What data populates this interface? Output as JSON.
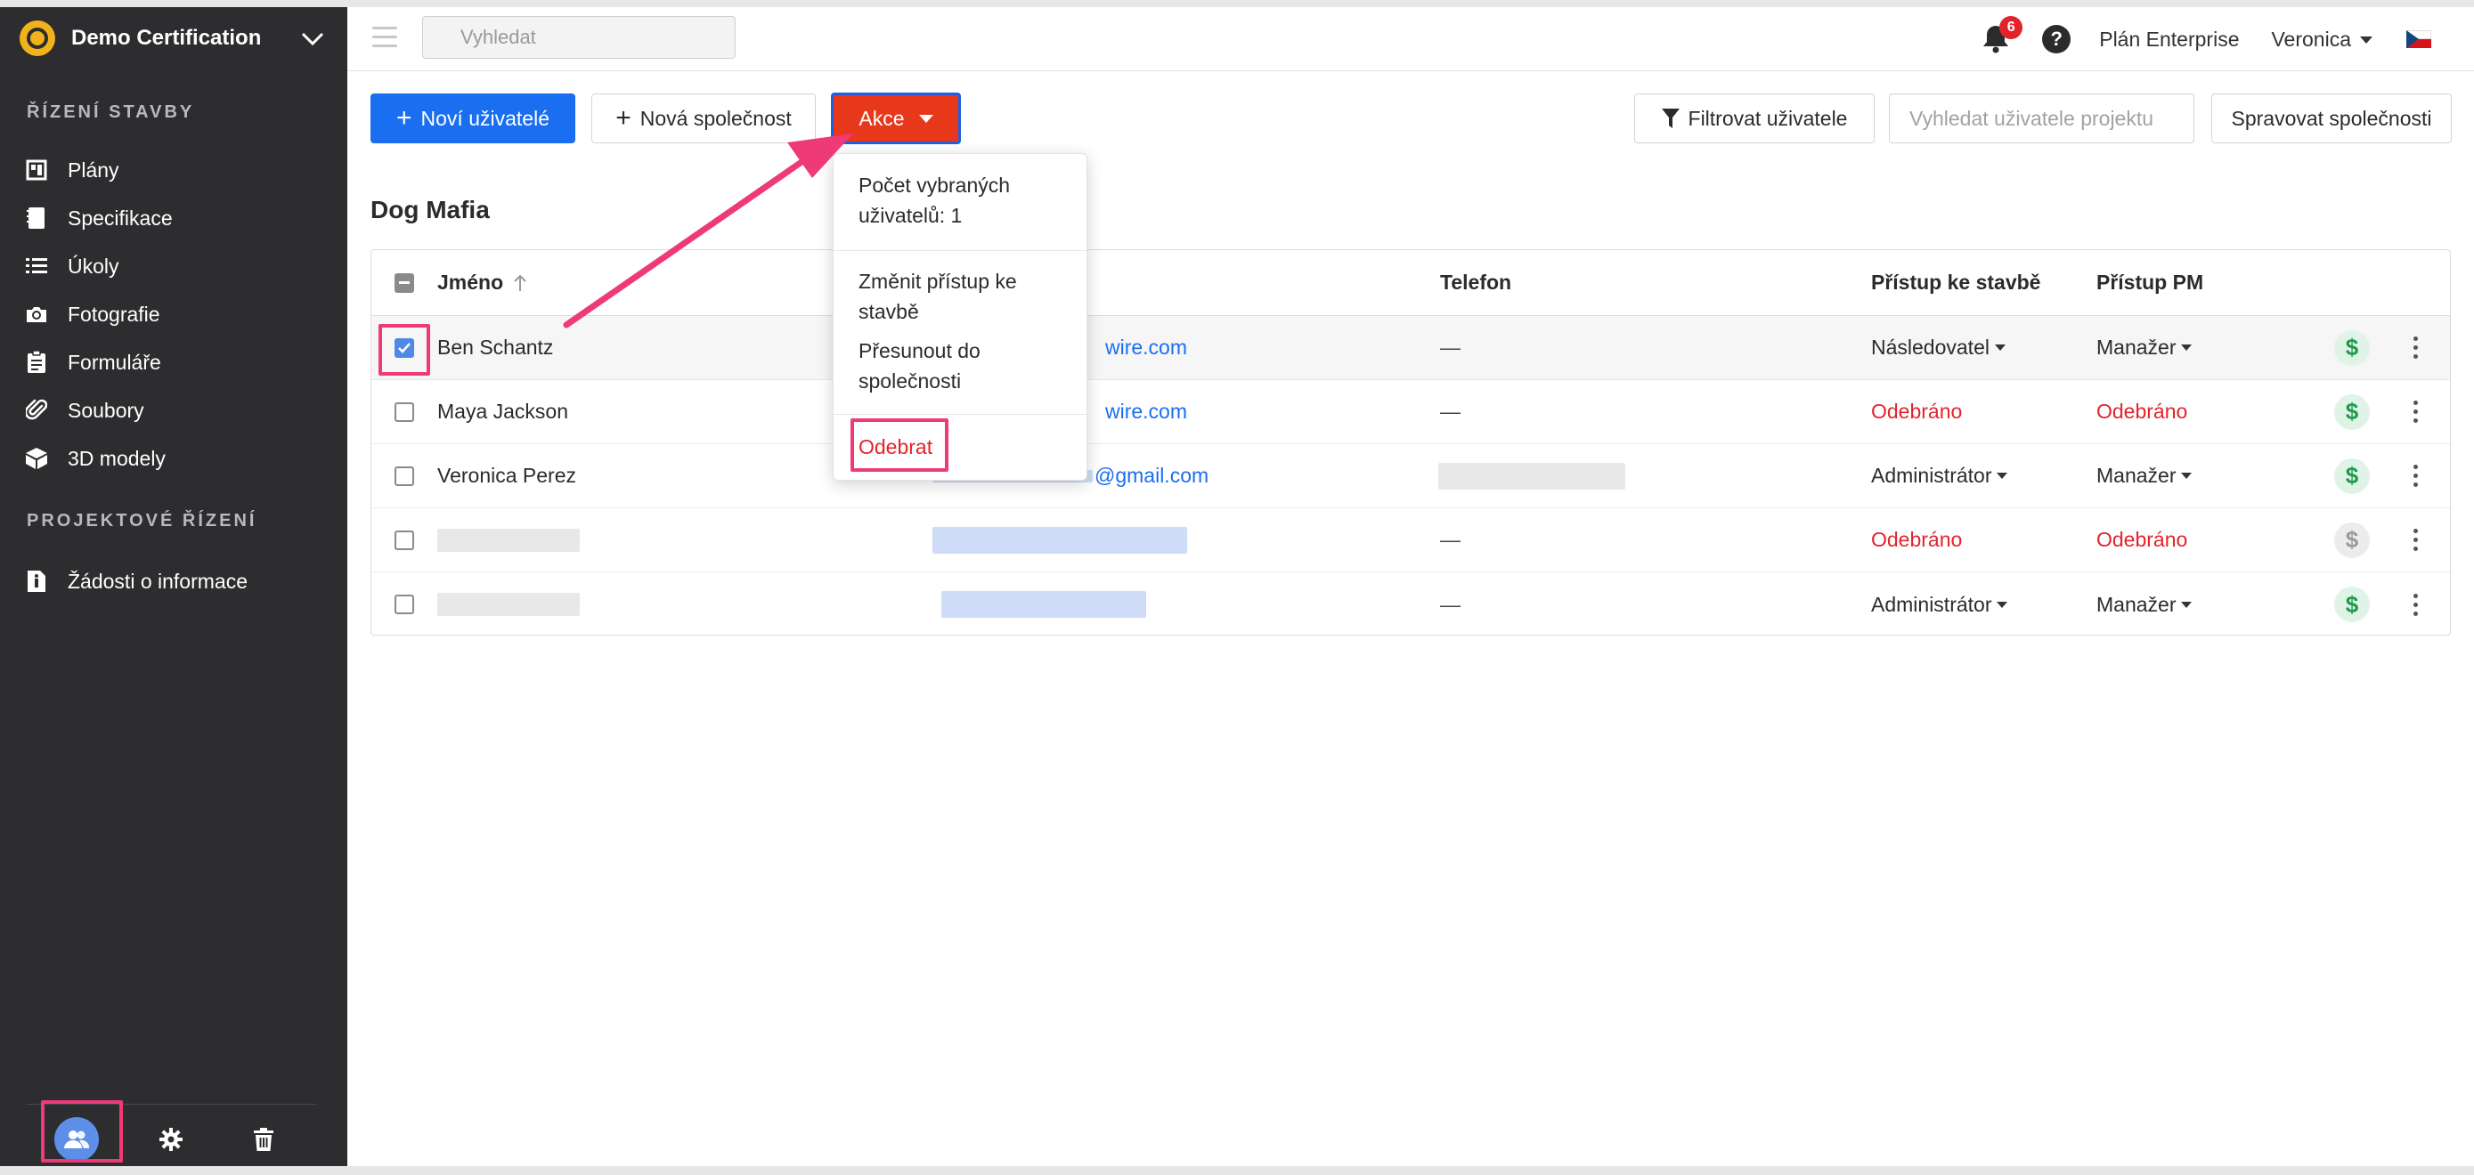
{
  "sidebar": {
    "project_name": "Demo Certification",
    "section_construction": "ŘÍZENÍ STAVBY",
    "construction_items": [
      {
        "label": "Plány",
        "icon": "plans-icon"
      },
      {
        "label": "Specifikace",
        "icon": "specifications-icon"
      },
      {
        "label": "Úkoly",
        "icon": "tasks-icon"
      },
      {
        "label": "Fotografie",
        "icon": "camera-icon"
      },
      {
        "label": "Formuláře",
        "icon": "forms-icon"
      },
      {
        "label": "Soubory",
        "icon": "paperclip-icon"
      },
      {
        "label": "3D modely",
        "icon": "cube-icon"
      }
    ],
    "section_pm": "PROJEKTOVÉ ŘÍZENÍ",
    "pm_items": [
      {
        "label": "Žádosti o informace",
        "icon": "rfi-icon"
      }
    ],
    "bottom_icons": [
      "users-icon",
      "gear-icon",
      "trash-icon"
    ]
  },
  "topbar": {
    "search_placeholder": "Vyhledat",
    "notification_count": "6",
    "help_label": "?",
    "plan": "Plán Enterprise",
    "user": "Veronica"
  },
  "toolbar": {
    "new_users": "Noví uživatelé",
    "new_company": "Nová společnost",
    "actions": "Akce",
    "filter_users": "Filtrovat uživatele",
    "search_users_placeholder": "Vyhledat uživatele projektu",
    "manage_companies": "Spravovat společnosti"
  },
  "page": {
    "title": "Dog Mafia"
  },
  "table": {
    "headers": {
      "name": "Jméno",
      "phone": "Telefon",
      "site_access": "Přístup ke stavbě",
      "pm_access": "Přístup PM"
    },
    "rows": [
      {
        "name": "Ben Schantz",
        "email": "wire.com",
        "phone": "—",
        "site_access": "Následovatel",
        "pm_access": "Manažer",
        "checked": true,
        "revoked": false
      },
      {
        "name": "Maya Jackson",
        "email": "wire.com",
        "phone": "—",
        "site_access": "Odebráno",
        "pm_access": "Odebráno",
        "checked": false,
        "revoked": true
      },
      {
        "name": "Veronica Perez",
        "email": "@gmail.com",
        "phone": "",
        "site_access": "Administrátor",
        "pm_access": "Manažer",
        "checked": false,
        "revoked": false
      },
      {
        "name": "",
        "email": "",
        "phone": "—",
        "site_access": "Odebráno",
        "pm_access": "Odebráno",
        "checked": false,
        "revoked": true
      },
      {
        "name": "",
        "email": "",
        "phone": "—",
        "site_access": "Administrátor",
        "pm_access": "Manažer",
        "checked": false,
        "revoked": false
      }
    ]
  },
  "dropdown": {
    "selected_count": "Počet vybraných uživatelů: 1",
    "change_access": "Změnit přístup ke stavbě",
    "move_to_company": "Přesunout do společnosti",
    "remove": "Odebrat"
  },
  "colors": {
    "primary": "#1a6ef0",
    "action_red": "#e8381c",
    "highlight_pink": "#ef3a78",
    "revoked_red": "#e3232b",
    "sidebar_bg": "#2d2d2f"
  }
}
